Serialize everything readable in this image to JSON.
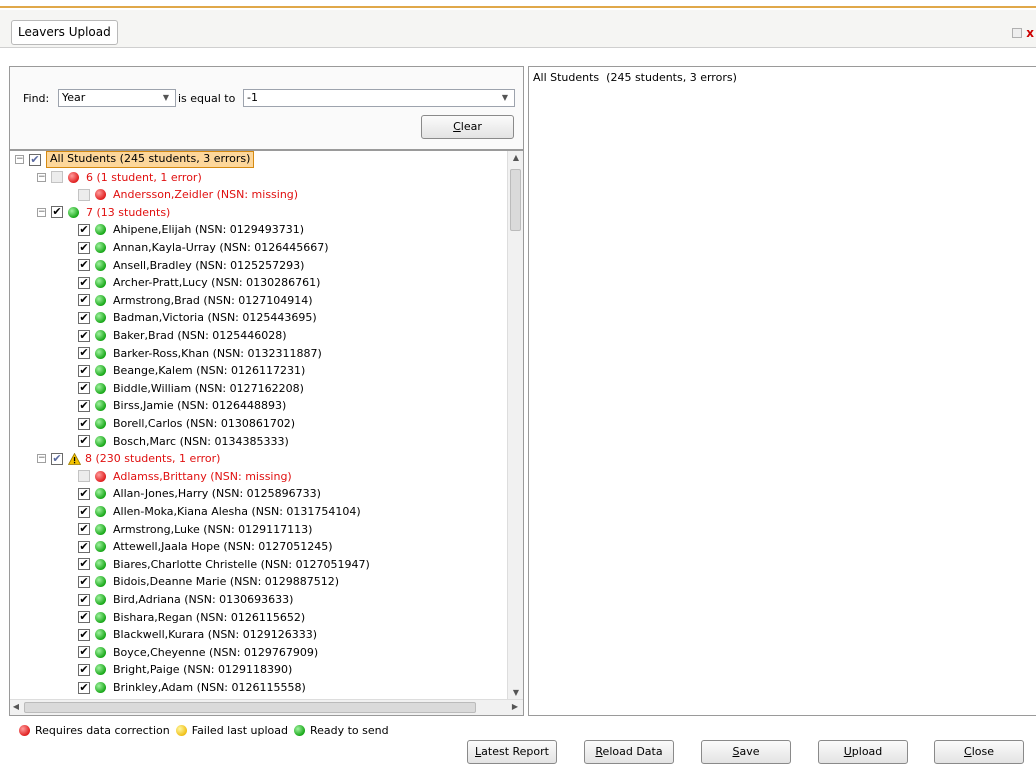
{
  "window": {
    "title": "Leavers Upload"
  },
  "find": {
    "label": "Find:",
    "field_value": "Year",
    "operator_label": "is equal to",
    "value": "-1",
    "clear_label": "Clear"
  },
  "tree": {
    "root": {
      "label": "All Students  (245 students, 3 errors)"
    },
    "groups": [
      {
        "label": "6  (1 student, 1 error)",
        "status": "red",
        "students": [
          {
            "name": "Andersson,Zeidler  (NSN: missing)",
            "status": "red",
            "checked": false
          }
        ]
      },
      {
        "label": "7  (13 students)",
        "status": "green",
        "students": [
          {
            "name": "Ahipene,Elijah  (NSN: 0129493731)",
            "status": "green",
            "checked": true
          },
          {
            "name": "Annan,Kayla-Urray  (NSN: 0126445667)",
            "status": "green",
            "checked": true
          },
          {
            "name": "Ansell,Bradley  (NSN: 0125257293)",
            "status": "green",
            "checked": true
          },
          {
            "name": "Archer-Pratt,Lucy  (NSN: 0130286761)",
            "status": "green",
            "checked": true
          },
          {
            "name": "Armstrong,Brad  (NSN: 0127104914)",
            "status": "green",
            "checked": true
          },
          {
            "name": "Badman,Victoria  (NSN: 0125443695)",
            "status": "green",
            "checked": true
          },
          {
            "name": "Baker,Brad  (NSN: 0125446028)",
            "status": "green",
            "checked": true
          },
          {
            "name": "Barker-Ross,Khan  (NSN: 0132311887)",
            "status": "green",
            "checked": true
          },
          {
            "name": "Beange,Kalem  (NSN: 0126117231)",
            "status": "green",
            "checked": true
          },
          {
            "name": "Biddle,William  (NSN: 0127162208)",
            "status": "green",
            "checked": true
          },
          {
            "name": "Birss,Jamie  (NSN: 0126448893)",
            "status": "green",
            "checked": true
          },
          {
            "name": "Borell,Carlos  (NSN: 0130861702)",
            "status": "green",
            "checked": true
          },
          {
            "name": "Bosch,Marc  (NSN: 0134385333)",
            "status": "green",
            "checked": true
          }
        ]
      },
      {
        "label": "8  (230 students, 1 error)",
        "status": "warning",
        "students": [
          {
            "name": "Adlamss,Brittany  (NSN: missing)",
            "status": "red",
            "checked": false
          },
          {
            "name": "Allan-Jones,Harry  (NSN: 0125896733)",
            "status": "green",
            "checked": true
          },
          {
            "name": "Allen-Moka,Kiana Alesha  (NSN: 0131754104)",
            "status": "green",
            "checked": true
          },
          {
            "name": "Armstrong,Luke  (NSN: 0129117113)",
            "status": "green",
            "checked": true
          },
          {
            "name": "Attewell,Jaala Hope  (NSN: 0127051245)",
            "status": "green",
            "checked": true
          },
          {
            "name": "Biares,Charlotte Christelle  (NSN: 0127051947)",
            "status": "green",
            "checked": true
          },
          {
            "name": "Bidois,Deanne Marie  (NSN: 0129887512)",
            "status": "green",
            "checked": true
          },
          {
            "name": "Bird,Adriana  (NSN: 0130693633)",
            "status": "green",
            "checked": true
          },
          {
            "name": "Bishara,Regan  (NSN: 0126115652)",
            "status": "green",
            "checked": true
          },
          {
            "name": "Blackwell,Kurara  (NSN: 0129126333)",
            "status": "green",
            "checked": true
          },
          {
            "name": "Boyce,Cheyenne  (NSN: 0129767909)",
            "status": "green",
            "checked": true
          },
          {
            "name": "Bright,Paige  (NSN: 0129118390)",
            "status": "green",
            "checked": true
          },
          {
            "name": "Brinkley,Adam  (NSN: 0126115558)",
            "status": "green",
            "checked": true
          }
        ]
      }
    ]
  },
  "legend": {
    "requires_correction": "Requires data correction",
    "failed_last_upload": "Failed last upload",
    "ready_to_send": "Ready to send"
  },
  "right_panel": {
    "title": "All Students  (245 students, 3 errors)"
  },
  "buttons": {
    "latest_report": {
      "label": "Latest Report",
      "mnemonic": "L",
      "rest": "atest Report"
    },
    "reload_data": {
      "label": "Reload Data",
      "mnemonic": "R",
      "rest": "eload Data"
    },
    "save": {
      "label": "Save",
      "mnemonic": "S",
      "rest": "ave"
    },
    "upload": {
      "label": "Upload",
      "mnemonic": "U",
      "rest": "pload"
    },
    "close": {
      "label": "Close",
      "mnemonic": "C",
      "rest": "lose"
    }
  },
  "colors": {
    "error_text": "#e01010",
    "selection_fill": "#fdd79b",
    "selection_border": "#d58a12",
    "accent_stripe": "#e0a84a"
  }
}
